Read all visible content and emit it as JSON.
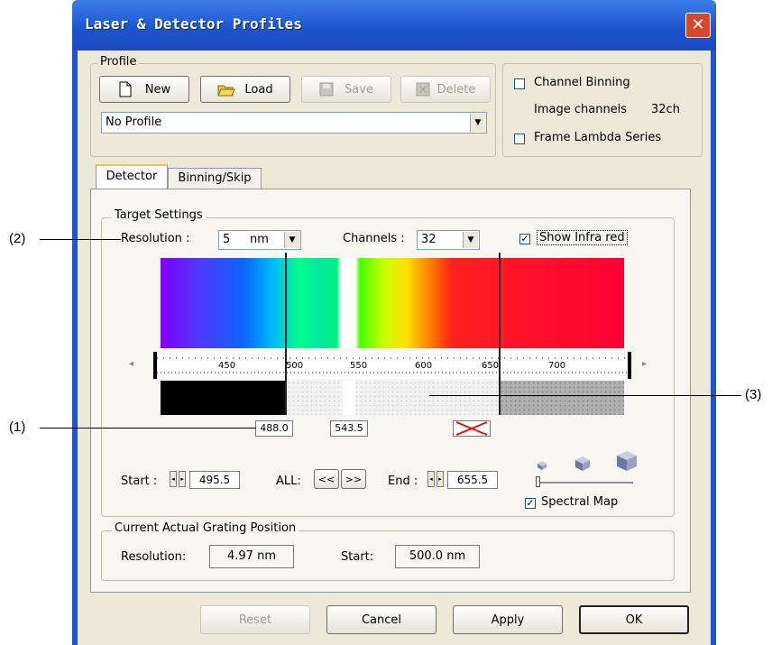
{
  "window": {
    "title": "Laser & Detector Profiles",
    "close_glyph": "✕"
  },
  "profile": {
    "group_label": "Profile",
    "new_label": "New",
    "load_label": "Load",
    "save_label": "Save",
    "delete_label": "Delete",
    "selected_profile": "No Profile"
  },
  "options": {
    "channel_binning_label": "Channel Binning",
    "channel_binning_checked": false,
    "image_channels_label": "Image channels",
    "image_channels_value": "32ch",
    "frame_lambda_label": "Frame Lambda Series",
    "frame_lambda_checked": false
  },
  "tabs": [
    {
      "label": "Detector",
      "active": true
    },
    {
      "label": "Binning/Skip",
      "active": false
    }
  ],
  "target_settings": {
    "group_label": "Target Settings",
    "resolution_label": "Resolution :",
    "resolution_value": "5",
    "resolution_unit": "nm",
    "channels_label": "Channels :",
    "channels_value": "32",
    "show_infrared_label": "Show Infra red",
    "show_infrared_checked": true
  },
  "scale": {
    "ticks": [
      "450",
      "500",
      "550",
      "600",
      "650",
      "700"
    ]
  },
  "markers": {
    "m1": "488.0",
    "m2": "543.5"
  },
  "range": {
    "start_label": "Start :",
    "start_value": "495.5",
    "all_label": "ALL:",
    "shrink_label": "<<",
    "expand_label": ">>",
    "end_label": "End :",
    "end_value": "655.5",
    "spectral_map_label": "Spectral Map",
    "spectral_map_checked": true
  },
  "grating": {
    "group_label": "Current Actual Grating Position",
    "resolution_label": "Resolution:",
    "resolution_value": "4.97 nm",
    "start_label": "Start:",
    "start_value": "500.0 nm"
  },
  "footer": {
    "reset_label": "Reset",
    "cancel_label": "Cancel",
    "apply_label": "Apply",
    "ok_label": "OK"
  },
  "annotations": {
    "a1": "(1)",
    "a2": "(2)",
    "a3": "(3)"
  },
  "icons": {
    "check": "✓",
    "dropdown": "▼",
    "scroll_left": "◂",
    "scroll_right": "▸"
  }
}
